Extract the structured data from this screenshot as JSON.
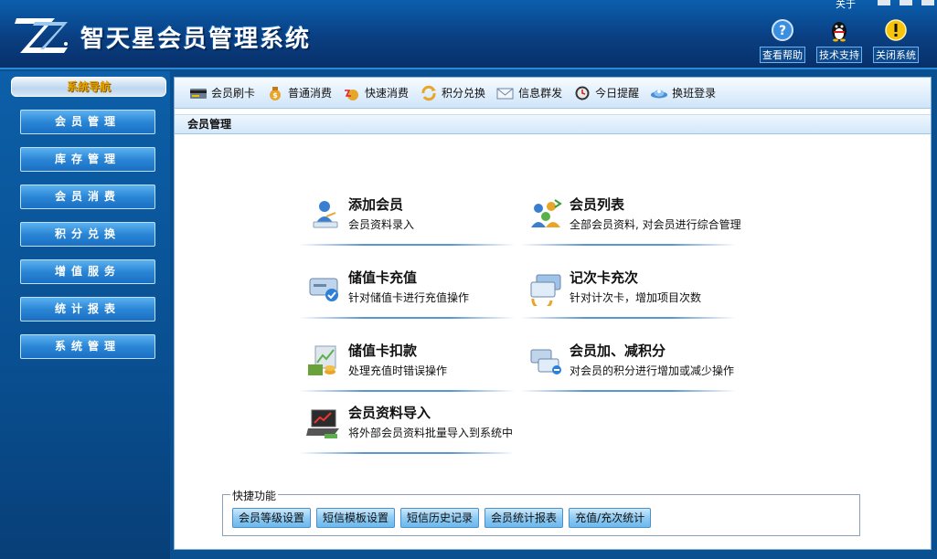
{
  "app": {
    "title": "智天星会员管理系统",
    "about": "关于"
  },
  "top_tools": [
    {
      "label": "查看帮助",
      "icon": "help-icon"
    },
    {
      "label": "技术支持",
      "icon": "qq-penguin-icon"
    },
    {
      "label": "关闭系统",
      "icon": "warning-icon"
    }
  ],
  "sidebar": {
    "title": "系统导航",
    "items": [
      "会员管理",
      "库存管理",
      "会员消费",
      "积分兑换",
      "增值服务",
      "统计报表",
      "系统管理"
    ]
  },
  "toolbar": {
    "items": [
      {
        "label": "会员刷卡",
        "icon": "card-reader-icon"
      },
      {
        "label": "普通消费",
        "icon": "money-bag-icon"
      },
      {
        "label": "快速消费",
        "icon": "fast-pay-icon"
      },
      {
        "label": "积分兑换",
        "icon": "exchange-icon"
      },
      {
        "label": "信息群发",
        "icon": "mail-icon"
      },
      {
        "label": "今日提醒",
        "icon": "clock-icon"
      },
      {
        "label": "换班登录",
        "icon": "shift-login-icon"
      }
    ]
  },
  "section": {
    "title": "会员管理"
  },
  "functions": [
    {
      "title": "添加会员",
      "desc": "会员资料录入",
      "icon": "add-member-icon"
    },
    {
      "title": "会员列表",
      "desc": "全部会员资料, 对会员进行综合管理",
      "icon": "member-list-icon"
    },
    {
      "title": "储值卡充值",
      "desc": "针对储值卡进行充值操作",
      "icon": "card-recharge-icon"
    },
    {
      "title": "记次卡充次",
      "desc": "针对计次卡，增加项目次数",
      "icon": "count-card-icon"
    },
    {
      "title": "储值卡扣款",
      "desc": "处理充值时错误操作",
      "icon": "card-deduct-icon"
    },
    {
      "title": "会员加、减积分",
      "desc": "对会员的积分进行增加或减少操作",
      "icon": "points-adjust-icon"
    },
    {
      "title": "会员资料导入",
      "desc": "将外部会员资料批量导入到系统中",
      "icon": "import-laptop-icon"
    }
  ],
  "quick": {
    "legend": "快捷功能",
    "buttons": [
      "会员等级设置",
      "短信模板设置",
      "短信历史记录",
      "会员统计报表",
      "充值/充次统计"
    ]
  },
  "colors": {
    "header": "#0a3f82",
    "sidebar": "#094f91",
    "nav_button": "#2b86d6",
    "nav_title_text": "#e3a200"
  }
}
